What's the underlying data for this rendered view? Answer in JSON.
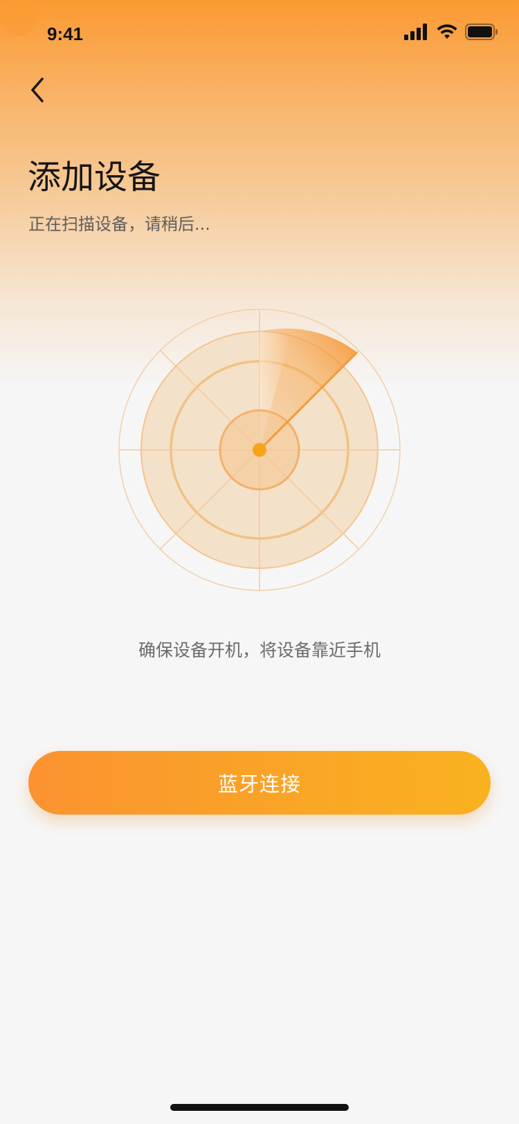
{
  "status_bar": {
    "time": "9:41",
    "icons": [
      "cellular-signal-icon",
      "wifi-icon",
      "battery-icon"
    ]
  },
  "header": {
    "back_icon": "chevron-left-icon",
    "title": "添加设备",
    "subtitle": "正在扫描设备，请稍后..."
  },
  "radar": {
    "icon": "radar-scan-icon",
    "accent_color": "#f5a043"
  },
  "tip": {
    "text": "确保设备开机，将设备靠近手机"
  },
  "action": {
    "bluetooth_label": "蓝牙连接"
  },
  "colors": {
    "brand_start": "#fb9330",
    "brand_end": "#f9b21f",
    "background": "#f6f6f6"
  }
}
